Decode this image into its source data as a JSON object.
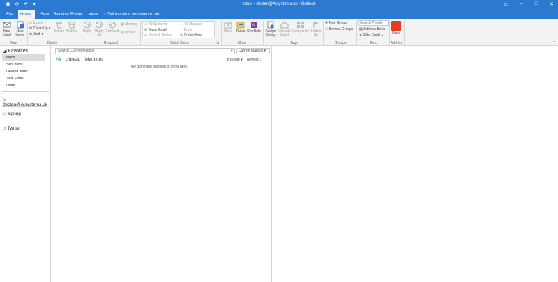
{
  "window": {
    "title": "Inbox - declan@Ajsystems.uk  -  Outlook"
  },
  "tabs": [
    {
      "label": "File"
    },
    {
      "label": "Home"
    },
    {
      "label": "Send / Receive"
    },
    {
      "label": "Folder"
    },
    {
      "label": "View"
    }
  ],
  "tell_me": "Tell me what you want to do",
  "ribbon": {
    "new_email": "New Email",
    "new_items": "New Items",
    "ignore": "Ignore",
    "clean_up": "Clean Up",
    "junk": "Junk",
    "delete": "Delete",
    "archive": "Archive",
    "reply": "Reply",
    "reply_all": "Reply All",
    "forward": "Forward",
    "meeting": "Meeting",
    "more": "More",
    "qs_aj_systems": "AJ Systems",
    "qs_team_email": "Team Email",
    "qs_reply_delete": "Reply & Delete",
    "qs_to_manager": "To Manager",
    "qs_done": "Done",
    "qs_create_new": "Create New",
    "move": "Move",
    "rules": "Rules",
    "onenote": "OneNote",
    "assign_policy": "Assign Policy",
    "unread_read": "Unread/ Read",
    "categorize": "Categorize",
    "follow_up": "Follow Up",
    "new_group": "New Group",
    "browse_groups": "Browse Groups",
    "search_people": "Search People",
    "address_book": "Address Book",
    "filter_email": "Filter Email",
    "store": "Store",
    "groups": {
      "new": "New",
      "delete": "Delete",
      "respond": "Respond",
      "quick_steps": "Quick Steps",
      "move": "Move",
      "tags": "Tags",
      "groups": "Groups",
      "find": "Find",
      "addins": "Add-ins"
    }
  },
  "sidebar": {
    "favorites_header": "Favorites",
    "items": [
      {
        "label": "Inbox"
      },
      {
        "label": "Sent Items"
      },
      {
        "label": "Deleted Items"
      },
      {
        "label": "Junk Email"
      },
      {
        "label": "Drafts"
      }
    ],
    "accounts": [
      {
        "label": "declan@Ajsystems.uk"
      },
      {
        "label": "signup"
      },
      {
        "label": "Twitter"
      }
    ]
  },
  "mail_list": {
    "search_placeholder": "Search Current Mailbox",
    "scope": "Current Mailbox",
    "filters": [
      {
        "label": "All"
      },
      {
        "label": "Unread"
      },
      {
        "label": "Mentions"
      }
    ],
    "sort_by": "By Date",
    "sort_order": "Newest",
    "empty_message": "We didn't find anything to show here."
  },
  "colors": {
    "accent": "#2b79d0",
    "ribbon_bg": "#f3f3f3"
  }
}
